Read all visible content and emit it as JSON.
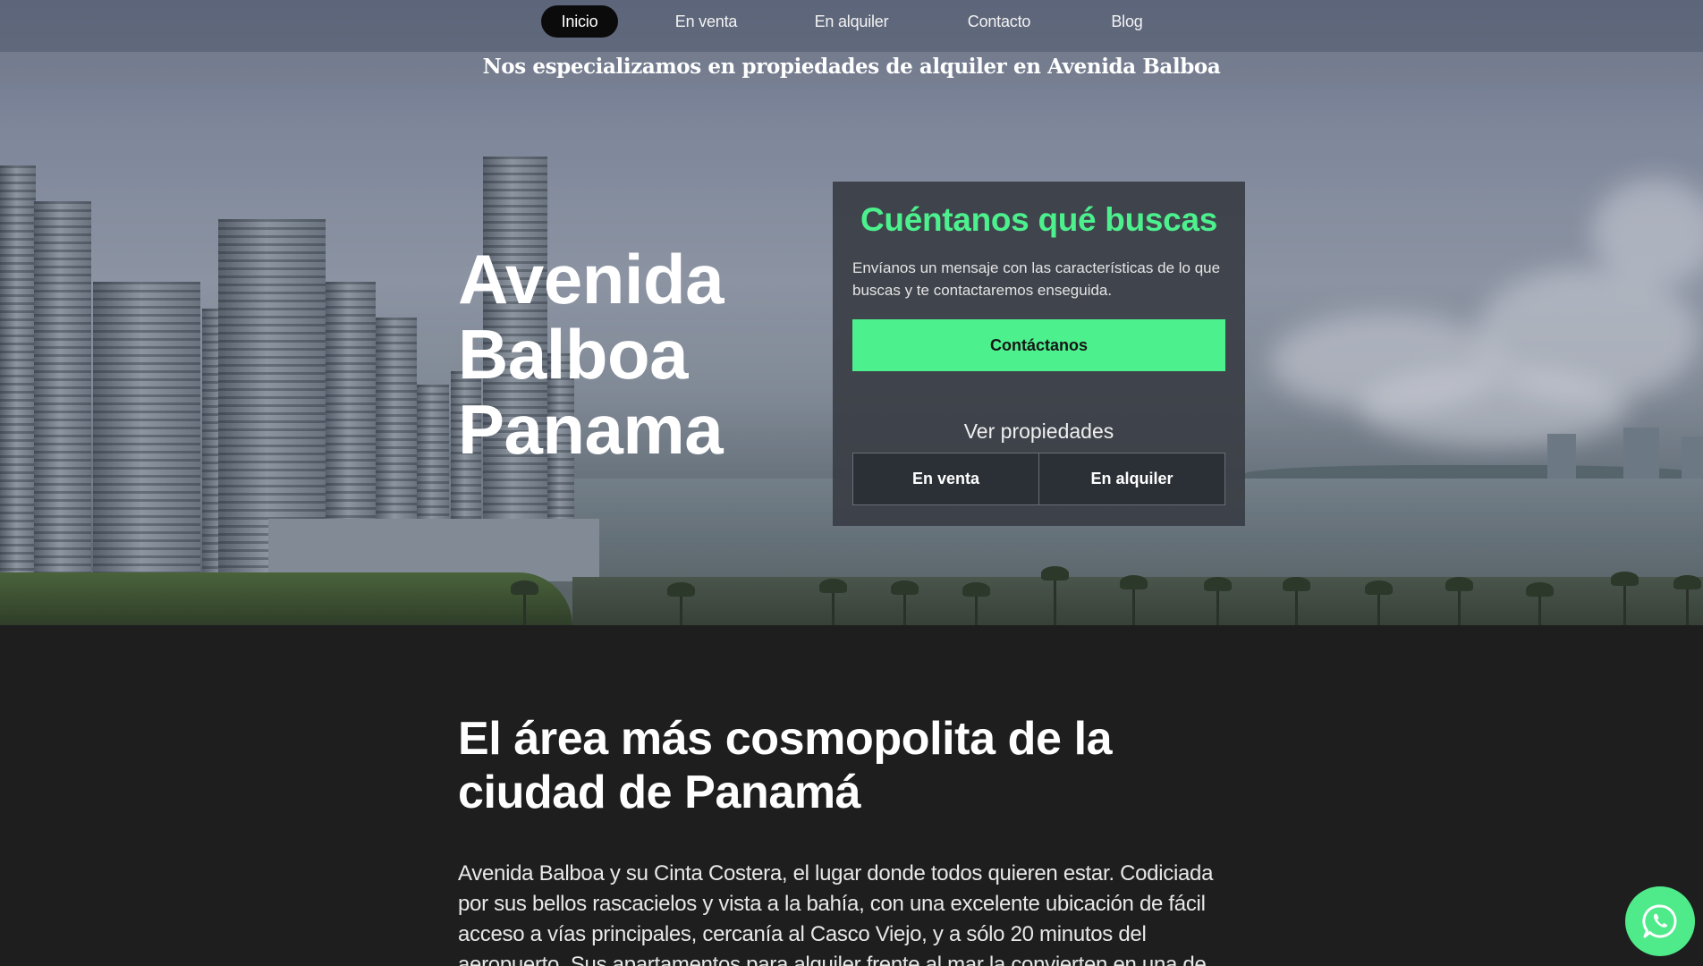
{
  "nav": {
    "items": [
      {
        "label": "Inicio",
        "active": true
      },
      {
        "label": "En venta",
        "active": false
      },
      {
        "label": "En alquiler",
        "active": false
      },
      {
        "label": "Contacto",
        "active": false
      },
      {
        "label": "Blog",
        "active": false
      }
    ]
  },
  "tagline": "Nos especializamos en propiedades de alquiler en Avenida Balboa",
  "hero": {
    "title_lines": [
      "Avenida",
      "Balboa",
      "Panama"
    ]
  },
  "card": {
    "title": "Cuéntanos qué buscas",
    "text": "Envíanos un mensaje con las características de lo que buscas y te contactaremos enseguida.",
    "contact_button": "Contáctanos",
    "properties_label": "Ver propiedades",
    "sale_button": "En venta",
    "rent_button": "En alquiler"
  },
  "section": {
    "title": "El área más cosmopolita de la ciudad de Panamá",
    "body": "Avenida Balboa y su Cinta Costera, el lugar donde todos quieren estar.  Codiciada por sus bellos rascacielos y vista a la bahía, con una excelente ubicación de fácil acceso a vías principales, cercanía al Casco Viejo, y a sólo 20 minutos del aeropuerto. Sus apartamentos para alquiler frente al mar la convierten en una de"
  },
  "colors": {
    "accent": "#4cf08d",
    "nav_active_bg": "#0b0b0b",
    "card_bg": "#3a3e46",
    "page_bg": "#1e1e1e",
    "whatsapp": "#4fea8a"
  },
  "icons": {
    "whatsapp": "whatsapp-icon"
  }
}
